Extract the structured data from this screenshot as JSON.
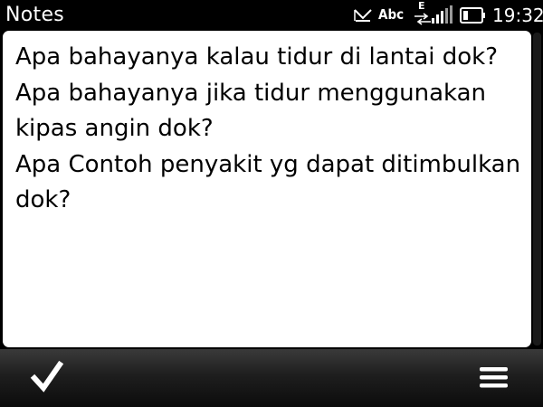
{
  "status_bar": {
    "app_title": "Notes",
    "input_mode": "Abc",
    "network_type": "E",
    "clock": "19:32",
    "icons": {
      "message": "envelope-indicator-icon",
      "network": "edge-network-icon",
      "signal": "signal-strength-icon",
      "battery": "battery-icon"
    }
  },
  "note": {
    "text": "Apa bahayanya kalau tidur di lantai dok?\nApa bahayanya jika tidur menggunakan kipas angin dok?\nApa Contoh penyakit yg dapat ditimbulkan dok?"
  },
  "toolbar": {
    "done_icon": "checkmark-icon",
    "menu_icon": "menu-icon"
  }
}
